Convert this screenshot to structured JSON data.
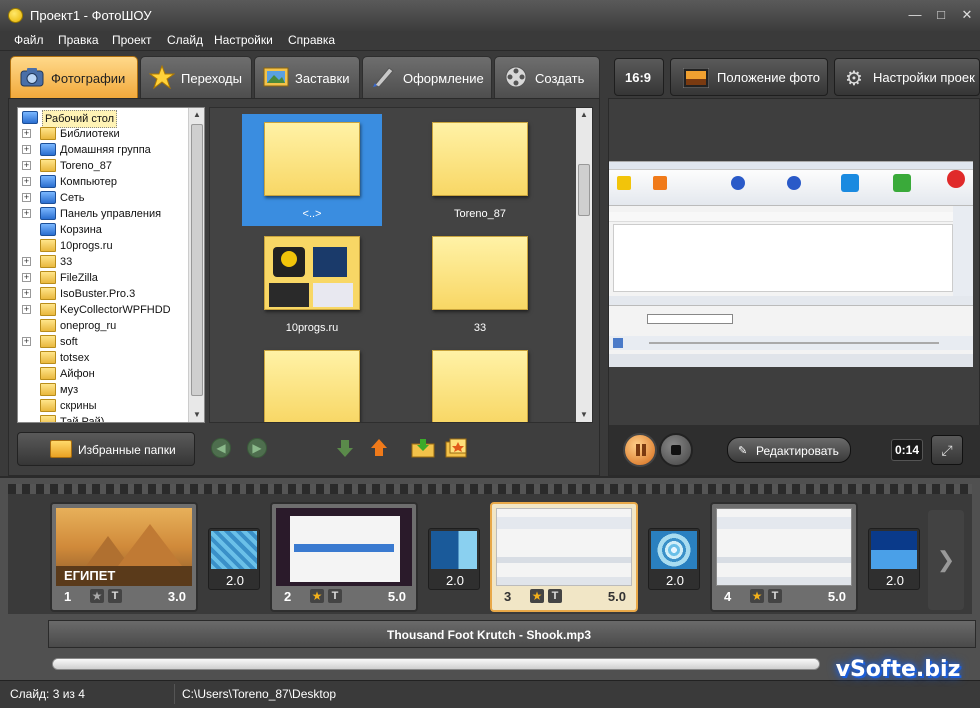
{
  "window": {
    "title": "Проект1 - ФотоШОУ"
  },
  "menu": [
    "Файл",
    "Правка",
    "Проект",
    "Слайд",
    "Настройки",
    "Справка"
  ],
  "tabs": [
    {
      "label": "Фотографии",
      "icon": "camera-icon",
      "active": true
    },
    {
      "label": "Переходы",
      "icon": "star-icon",
      "active": false
    },
    {
      "label": "Заставки",
      "icon": "picture-icon",
      "active": false
    },
    {
      "label": "Оформление",
      "icon": "brush-icon",
      "active": false
    },
    {
      "label": "Создать",
      "icon": "film-reel-icon",
      "active": false
    }
  ],
  "right_toolbar": {
    "aspect": "16:9",
    "photo_position": "Положение фото",
    "project_settings": "Настройки проек"
  },
  "tree": {
    "root": "Рабочий стол",
    "items": [
      {
        "label": "Библиотеки",
        "expandable": true,
        "icon": "folder-icon"
      },
      {
        "label": "Домашняя группа",
        "expandable": true,
        "icon": "homegroup-icon"
      },
      {
        "label": "Toreno_87",
        "expandable": true,
        "icon": "user-folder-icon"
      },
      {
        "label": "Компьютер",
        "expandable": true,
        "icon": "computer-icon"
      },
      {
        "label": "Сеть",
        "expandable": true,
        "icon": "network-icon"
      },
      {
        "label": "Панель управления",
        "expandable": true,
        "icon": "control-panel-icon"
      },
      {
        "label": "Корзина",
        "expandable": false,
        "icon": "recycle-bin-icon"
      },
      {
        "label": "10progs.ru",
        "expandable": false,
        "icon": "folder-icon"
      },
      {
        "label": "33",
        "expandable": true,
        "icon": "folder-icon"
      },
      {
        "label": "FileZilla",
        "expandable": true,
        "icon": "folder-icon"
      },
      {
        "label": "IsoBuster.Pro.3",
        "expandable": true,
        "icon": "folder-icon"
      },
      {
        "label": "KeyCollectorWPFHDD",
        "expandable": true,
        "icon": "folder-icon"
      },
      {
        "label": "oneprog_ru",
        "expandable": false,
        "icon": "folder-icon"
      },
      {
        "label": "soft",
        "expandable": true,
        "icon": "folder-icon"
      },
      {
        "label": "totsex",
        "expandable": false,
        "icon": "folder-icon"
      },
      {
        "label": "Айфон",
        "expandable": false,
        "icon": "folder-icon"
      },
      {
        "label": "муз",
        "expandable": false,
        "icon": "folder-icon"
      },
      {
        "label": "скрины",
        "expandable": false,
        "icon": "folder-icon"
      },
      {
        "label": "Тай Рай)",
        "expandable": false,
        "icon": "folder-icon"
      }
    ]
  },
  "thumbnails": [
    {
      "label": "<..>",
      "selected": true
    },
    {
      "label": "Toreno_87",
      "selected": false
    },
    {
      "label": "10progs.ru",
      "selected": false
    },
    {
      "label": "33",
      "selected": false
    },
    {
      "label": "",
      "selected": false
    },
    {
      "label": "",
      "selected": false
    }
  ],
  "favorites_button": "Избранные папки",
  "player": {
    "edit_label": "Редактировать",
    "time": "0:14"
  },
  "slides": [
    {
      "num": "1",
      "duration": "3.0",
      "caption": "ЕГИПЕТ",
      "selected": false
    },
    {
      "num": "2",
      "duration": "5.0",
      "selected": false
    },
    {
      "num": "3",
      "duration": "5.0",
      "selected": true
    },
    {
      "num": "4",
      "duration": "5.0",
      "selected": false
    }
  ],
  "transitions": [
    "2.0",
    "2.0",
    "2.0",
    "2.0"
  ],
  "audio_track": "Thousand Foot Krutch - Shook.mp3",
  "status": {
    "slide": "Слайд: 3 из 4",
    "path": "C:\\Users\\Toreno_87\\Desktop"
  },
  "watermark": "vSofte.biz",
  "colors": {
    "accent": "#f2a93b",
    "selection": "#3a8de0",
    "folder": "#f8d765"
  }
}
